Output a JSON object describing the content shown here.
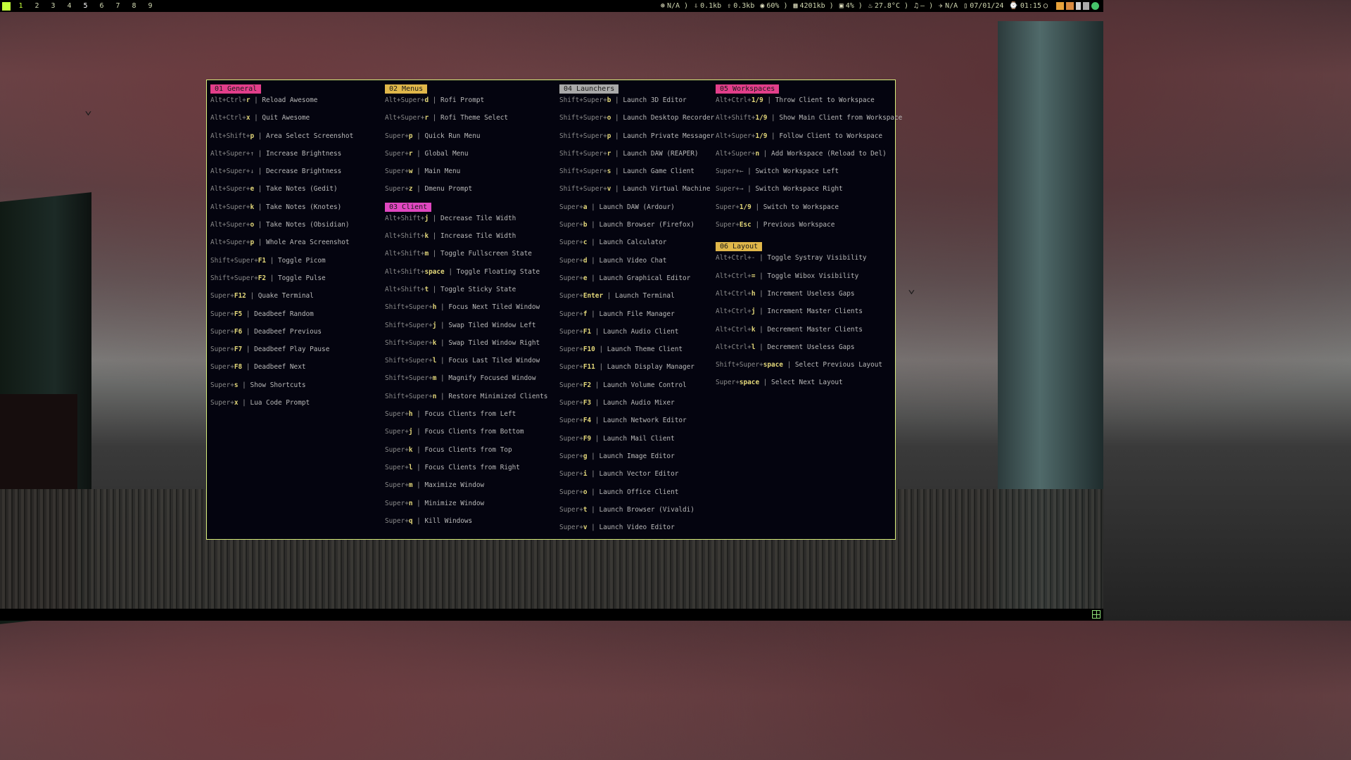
{
  "workspaces": [
    "1",
    "2",
    "3",
    "4",
    "5",
    "6",
    "7",
    "8",
    "9"
  ],
  "status": {
    "vpn": "N/A )",
    "down": "0.1kb",
    "up": "0.3kb",
    "volume": "60% )",
    "memory": "4201kb )",
    "cpu": "4% )",
    "temp": "27.8°C )",
    "music": "– )",
    "weather": "N/A",
    "date": "07/01/24",
    "time": "01:15"
  },
  "colors": {
    "general": "#e23e8a",
    "menus": "#e0b74a",
    "client": "#e047c0",
    "launchers": "#a9a9a9",
    "workspaces": "#e23e8a",
    "layout": "#e0b74a"
  },
  "sections": {
    "general": {
      "title": "01 General",
      "rows": [
        {
          "mod": "Alt+Ctrl+",
          "key": "r",
          "desc": "Reload Awesome"
        },
        {
          "mod": "Alt+Ctrl+",
          "key": "x",
          "desc": "Quit Awesome"
        },
        {
          "mod": "Alt+Shift+",
          "key": "p",
          "desc": "Area Select Screenshot"
        },
        {
          "mod": "Alt+Super+↑",
          "key": "",
          "desc": "Increase Brightness"
        },
        {
          "mod": "Alt+Super+↓",
          "key": "",
          "desc": "Decrease Brightness"
        },
        {
          "mod": "Alt+Super+",
          "key": "e",
          "desc": "Take Notes (Gedit)"
        },
        {
          "mod": "Alt+Super+",
          "key": "k",
          "desc": "Take Notes (Knotes)"
        },
        {
          "mod": "Alt+Super+",
          "key": "o",
          "desc": "Take Notes (Obsidian)"
        },
        {
          "mod": "Alt+Super+",
          "key": "p",
          "desc": "Whole Area Screenshot"
        },
        {
          "mod": "Shift+Super+",
          "key": "F1",
          "desc": "Toggle Picom"
        },
        {
          "mod": "Shift+Super+",
          "key": "F2",
          "desc": "Toggle Pulse"
        },
        {
          "mod": "Super+",
          "key": "F12",
          "desc": "Quake Terminal"
        },
        {
          "mod": "Super+",
          "key": "F5",
          "desc": "Deadbeef Random"
        },
        {
          "mod": "Super+",
          "key": "F6",
          "desc": "Deadbeef Previous"
        },
        {
          "mod": "Super+",
          "key": "F7",
          "desc": "Deadbeef Play Pause"
        },
        {
          "mod": "Super+",
          "key": "F8",
          "desc": "Deadbeef Next"
        },
        {
          "mod": "Super+",
          "key": "s",
          "desc": "Show Shortcuts"
        },
        {
          "mod": "Super+",
          "key": "x",
          "desc": "Lua Code Prompt"
        }
      ]
    },
    "menus": {
      "title": "02 Menus",
      "rows": [
        {
          "mod": "Alt+Super+",
          "key": "d",
          "desc": "Rofi Prompt"
        },
        {
          "mod": "Alt+Super+",
          "key": "r",
          "desc": "Rofi Theme Select"
        },
        {
          "mod": "Super+",
          "key": "p",
          "desc": "Quick Run Menu"
        },
        {
          "mod": "Super+",
          "key": "r",
          "desc": "Global Menu"
        },
        {
          "mod": "Super+",
          "key": "w",
          "desc": "Main Menu"
        },
        {
          "mod": "Super+",
          "key": "z",
          "desc": "Dmenu Prompt"
        }
      ]
    },
    "client": {
      "title": "03 Client",
      "rows": [
        {
          "mod": "Alt+Shift+",
          "key": "j",
          "desc": "Decrease Tile Width"
        },
        {
          "mod": "Alt+Shift+",
          "key": "k",
          "desc": "Increase Tile Width"
        },
        {
          "mod": "Alt+Shift+",
          "key": "m",
          "desc": "Toggle Fullscreen State"
        },
        {
          "mod": "Alt+Shift+",
          "key": "space",
          "desc": "Toggle Floating State"
        },
        {
          "mod": "Alt+Shift+",
          "key": "t",
          "desc": "Toggle Sticky State"
        },
        {
          "mod": "Shift+Super+",
          "key": "h",
          "desc": "Focus Next Tiled Window"
        },
        {
          "mod": "Shift+Super+",
          "key": "j",
          "desc": "Swap Tiled Window Left"
        },
        {
          "mod": "Shift+Super+",
          "key": "k",
          "desc": "Swap Tiled Window Right"
        },
        {
          "mod": "Shift+Super+",
          "key": "l",
          "desc": "Focus Last Tiled Window"
        },
        {
          "mod": "Shift+Super+",
          "key": "m",
          "desc": "Magnify Focused Window"
        },
        {
          "mod": "Shift+Super+",
          "key": "n",
          "desc": "Restore Minimized Clients"
        },
        {
          "mod": "Super+",
          "key": "h",
          "desc": "Focus Clients from Left"
        },
        {
          "mod": "Super+",
          "key": "j",
          "desc": "Focus Clients from Bottom"
        },
        {
          "mod": "Super+",
          "key": "k",
          "desc": "Focus Clients from Top"
        },
        {
          "mod": "Super+",
          "key": "l",
          "desc": "Focus Clients from Right"
        },
        {
          "mod": "Super+",
          "key": "m",
          "desc": "Maximize Window"
        },
        {
          "mod": "Super+",
          "key": "n",
          "desc": "Minimize Window"
        },
        {
          "mod": "Super+",
          "key": "q",
          "desc": "Kill Windows"
        }
      ]
    },
    "launchers": {
      "title": "04 Launchers",
      "rows": [
        {
          "mod": "Shift+Super+",
          "key": "b",
          "desc": "Launch 3D Editor"
        },
        {
          "mod": "Shift+Super+",
          "key": "o",
          "desc": "Launch Desktop Recorder"
        },
        {
          "mod": "Shift+Super+",
          "key": "p",
          "desc": "Launch Private Messager"
        },
        {
          "mod": "Shift+Super+",
          "key": "r",
          "desc": "Launch DAW (REAPER)"
        },
        {
          "mod": "Shift+Super+",
          "key": "s",
          "desc": "Launch Game Client"
        },
        {
          "mod": "Shift+Super+",
          "key": "v",
          "desc": "Launch Virtual Machine"
        },
        {
          "mod": "Super+",
          "key": "a",
          "desc": "Launch DAW (Ardour)"
        },
        {
          "mod": "Super+",
          "key": "b",
          "desc": "Launch Browser (Firefox)"
        },
        {
          "mod": "Super+",
          "key": "c",
          "desc": "Launch Calculator"
        },
        {
          "mod": "Super+",
          "key": "d",
          "desc": "Launch Video Chat"
        },
        {
          "mod": "Super+",
          "key": "e",
          "desc": "Launch Graphical Editor"
        },
        {
          "mod": "Super+",
          "key": "Enter",
          "desc": "Launch Terminal"
        },
        {
          "mod": "Super+",
          "key": "f",
          "desc": "Launch File Manager"
        },
        {
          "mod": "Super+",
          "key": "F1",
          "desc": "Launch Audio Client"
        },
        {
          "mod": "Super+",
          "key": "F10",
          "desc": "Launch Theme Client"
        },
        {
          "mod": "Super+",
          "key": "F11",
          "desc": "Launch Display Manager"
        },
        {
          "mod": "Super+",
          "key": "F2",
          "desc": "Launch Volume Control"
        },
        {
          "mod": "Super+",
          "key": "F3",
          "desc": "Launch Audio Mixer"
        },
        {
          "mod": "Super+",
          "key": "F4",
          "desc": "Launch Network Editor"
        },
        {
          "mod": "Super+",
          "key": "F9",
          "desc": "Launch Mail Client"
        },
        {
          "mod": "Super+",
          "key": "g",
          "desc": "Launch Image Editor"
        },
        {
          "mod": "Super+",
          "key": "i",
          "desc": "Launch Vector Editor"
        },
        {
          "mod": "Super+",
          "key": "o",
          "desc": "Launch Office Client"
        },
        {
          "mod": "Super+",
          "key": "t",
          "desc": "Launch Browser (Vivaldi)"
        },
        {
          "mod": "Super+",
          "key": "v",
          "desc": "Launch Video Editor"
        }
      ]
    },
    "workspaces": {
      "title": "05 Workspaces",
      "rows": [
        {
          "mod": "Alt+Ctrl+",
          "key": "1/9",
          "desc": "Throw Client to Workspace"
        },
        {
          "mod": "Alt+Shift+",
          "key": "1/9",
          "desc": "Show Main Client from Workspace"
        },
        {
          "mod": "Alt+Super+",
          "key": "1/9",
          "desc": "Follow Client to Workspace"
        },
        {
          "mod": "Alt+Super+",
          "key": "n",
          "desc": "Add Workspace (Reload to Del)"
        },
        {
          "mod": "Super+←",
          "key": "",
          "desc": "Switch Workspace Left"
        },
        {
          "mod": "Super+→",
          "key": "",
          "desc": "Switch Workspace Right"
        },
        {
          "mod": "Super+",
          "key": "1/9",
          "desc": "Switch to Workspace"
        },
        {
          "mod": "Super+",
          "key": "Esc",
          "desc": "Previous Workspace"
        }
      ]
    },
    "layout": {
      "title": "06 Layout",
      "rows": [
        {
          "mod": "Alt+Ctrl+-",
          "key": "",
          "desc": "Toggle Systray Visibility"
        },
        {
          "mod": "Alt+Ctrl+",
          "key": "=",
          "desc": "Toggle Wibox Visibility"
        },
        {
          "mod": "Alt+Ctrl+",
          "key": "h",
          "desc": "Increment Useless Gaps"
        },
        {
          "mod": "Alt+Ctrl+",
          "key": "j",
          "desc": "Increment Master Clients"
        },
        {
          "mod": "Alt+Ctrl+",
          "key": "k",
          "desc": "Decrement Master Clients"
        },
        {
          "mod": "Alt+Ctrl+",
          "key": "l",
          "desc": "Decrement Useless Gaps"
        },
        {
          "mod": "Shift+Super+",
          "key": "space",
          "desc": "Select Previous Layout"
        },
        {
          "mod": "Super+",
          "key": "space",
          "desc": "Select Next Layout"
        }
      ]
    }
  }
}
